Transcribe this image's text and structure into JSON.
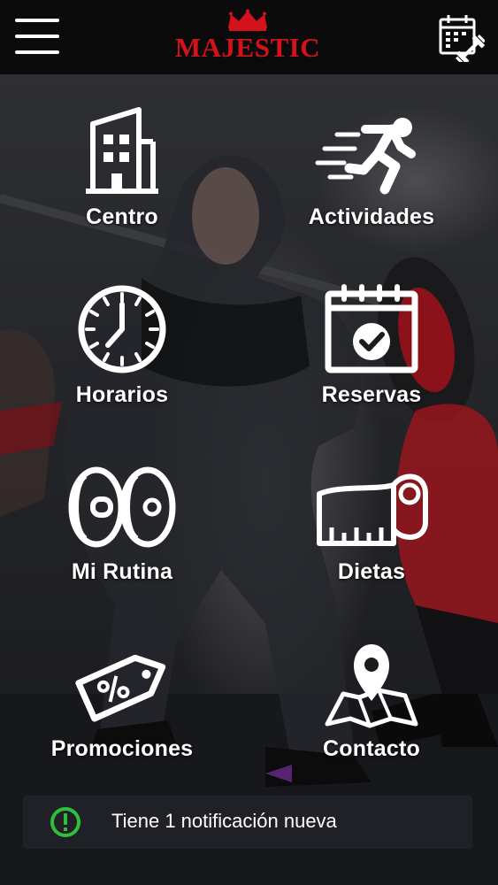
{
  "header": {
    "brand": "MAJESTIC",
    "menu_icon": "hamburger-menu-icon",
    "calendar_icon": "calendar-dumbbell-icon",
    "brand_color": "#d4121c"
  },
  "menu": {
    "centro": {
      "label": "Centro",
      "icon": "building-icon"
    },
    "actividades": {
      "label": "Actividades",
      "icon": "running-man-icon"
    },
    "horarios": {
      "label": "Horarios",
      "icon": "clock-icon"
    },
    "reservas": {
      "label": "Reservas",
      "icon": "calendar-check-icon"
    },
    "mi_rutina": {
      "label": "Mi Rutina",
      "icon": "weight-plates-icon"
    },
    "dietas": {
      "label": "Dietas",
      "icon": "measuring-tape-icon"
    },
    "promociones": {
      "label": "Promociones",
      "icon": "percent-tag-icon"
    },
    "contacto": {
      "label": "Contacto",
      "icon": "map-pin-icon"
    }
  },
  "notification": {
    "text": "Tiene 1 notificación nueva",
    "icon": "exclamation-circle-icon",
    "icon_color": "#2fbf3c"
  }
}
